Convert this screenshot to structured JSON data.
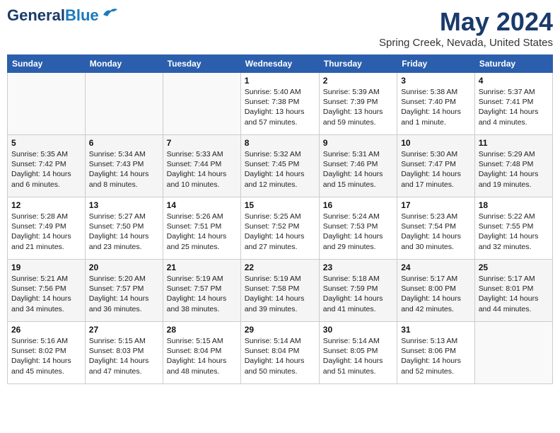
{
  "header": {
    "logo_line1": "General",
    "logo_line2": "Blue",
    "month_year": "May 2024",
    "location": "Spring Creek, Nevada, United States"
  },
  "weekdays": [
    "Sunday",
    "Monday",
    "Tuesday",
    "Wednesday",
    "Thursday",
    "Friday",
    "Saturday"
  ],
  "weeks": [
    [
      {
        "day": "",
        "info": ""
      },
      {
        "day": "",
        "info": ""
      },
      {
        "day": "",
        "info": ""
      },
      {
        "day": "1",
        "info": "Sunrise: 5:40 AM\nSunset: 7:38 PM\nDaylight: 13 hours and 57 minutes."
      },
      {
        "day": "2",
        "info": "Sunrise: 5:39 AM\nSunset: 7:39 PM\nDaylight: 13 hours and 59 minutes."
      },
      {
        "day": "3",
        "info": "Sunrise: 5:38 AM\nSunset: 7:40 PM\nDaylight: 14 hours and 1 minute."
      },
      {
        "day": "4",
        "info": "Sunrise: 5:37 AM\nSunset: 7:41 PM\nDaylight: 14 hours and 4 minutes."
      }
    ],
    [
      {
        "day": "5",
        "info": "Sunrise: 5:35 AM\nSunset: 7:42 PM\nDaylight: 14 hours and 6 minutes."
      },
      {
        "day": "6",
        "info": "Sunrise: 5:34 AM\nSunset: 7:43 PM\nDaylight: 14 hours and 8 minutes."
      },
      {
        "day": "7",
        "info": "Sunrise: 5:33 AM\nSunset: 7:44 PM\nDaylight: 14 hours and 10 minutes."
      },
      {
        "day": "8",
        "info": "Sunrise: 5:32 AM\nSunset: 7:45 PM\nDaylight: 14 hours and 12 minutes."
      },
      {
        "day": "9",
        "info": "Sunrise: 5:31 AM\nSunset: 7:46 PM\nDaylight: 14 hours and 15 minutes."
      },
      {
        "day": "10",
        "info": "Sunrise: 5:30 AM\nSunset: 7:47 PM\nDaylight: 14 hours and 17 minutes."
      },
      {
        "day": "11",
        "info": "Sunrise: 5:29 AM\nSunset: 7:48 PM\nDaylight: 14 hours and 19 minutes."
      }
    ],
    [
      {
        "day": "12",
        "info": "Sunrise: 5:28 AM\nSunset: 7:49 PM\nDaylight: 14 hours and 21 minutes."
      },
      {
        "day": "13",
        "info": "Sunrise: 5:27 AM\nSunset: 7:50 PM\nDaylight: 14 hours and 23 minutes."
      },
      {
        "day": "14",
        "info": "Sunrise: 5:26 AM\nSunset: 7:51 PM\nDaylight: 14 hours and 25 minutes."
      },
      {
        "day": "15",
        "info": "Sunrise: 5:25 AM\nSunset: 7:52 PM\nDaylight: 14 hours and 27 minutes."
      },
      {
        "day": "16",
        "info": "Sunrise: 5:24 AM\nSunset: 7:53 PM\nDaylight: 14 hours and 29 minutes."
      },
      {
        "day": "17",
        "info": "Sunrise: 5:23 AM\nSunset: 7:54 PM\nDaylight: 14 hours and 30 minutes."
      },
      {
        "day": "18",
        "info": "Sunrise: 5:22 AM\nSunset: 7:55 PM\nDaylight: 14 hours and 32 minutes."
      }
    ],
    [
      {
        "day": "19",
        "info": "Sunrise: 5:21 AM\nSunset: 7:56 PM\nDaylight: 14 hours and 34 minutes."
      },
      {
        "day": "20",
        "info": "Sunrise: 5:20 AM\nSunset: 7:57 PM\nDaylight: 14 hours and 36 minutes."
      },
      {
        "day": "21",
        "info": "Sunrise: 5:19 AM\nSunset: 7:57 PM\nDaylight: 14 hours and 38 minutes."
      },
      {
        "day": "22",
        "info": "Sunrise: 5:19 AM\nSunset: 7:58 PM\nDaylight: 14 hours and 39 minutes."
      },
      {
        "day": "23",
        "info": "Sunrise: 5:18 AM\nSunset: 7:59 PM\nDaylight: 14 hours and 41 minutes."
      },
      {
        "day": "24",
        "info": "Sunrise: 5:17 AM\nSunset: 8:00 PM\nDaylight: 14 hours and 42 minutes."
      },
      {
        "day": "25",
        "info": "Sunrise: 5:17 AM\nSunset: 8:01 PM\nDaylight: 14 hours and 44 minutes."
      }
    ],
    [
      {
        "day": "26",
        "info": "Sunrise: 5:16 AM\nSunset: 8:02 PM\nDaylight: 14 hours and 45 minutes."
      },
      {
        "day": "27",
        "info": "Sunrise: 5:15 AM\nSunset: 8:03 PM\nDaylight: 14 hours and 47 minutes."
      },
      {
        "day": "28",
        "info": "Sunrise: 5:15 AM\nSunset: 8:04 PM\nDaylight: 14 hours and 48 minutes."
      },
      {
        "day": "29",
        "info": "Sunrise: 5:14 AM\nSunset: 8:04 PM\nDaylight: 14 hours and 50 minutes."
      },
      {
        "day": "30",
        "info": "Sunrise: 5:14 AM\nSunset: 8:05 PM\nDaylight: 14 hours and 51 minutes."
      },
      {
        "day": "31",
        "info": "Sunrise: 5:13 AM\nSunset: 8:06 PM\nDaylight: 14 hours and 52 minutes."
      },
      {
        "day": "",
        "info": ""
      }
    ]
  ]
}
